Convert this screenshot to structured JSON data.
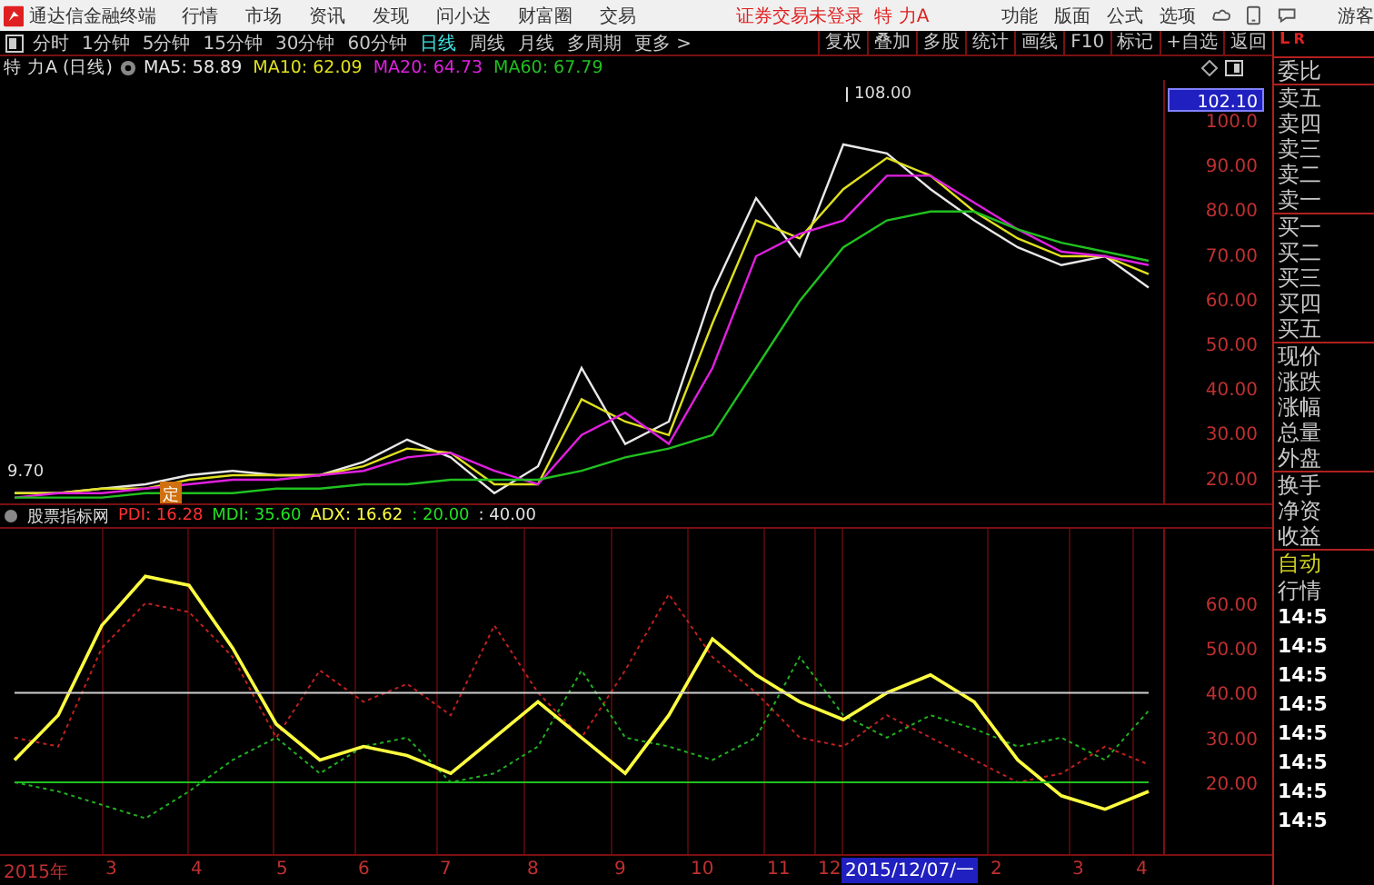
{
  "title_bar": {
    "app_name": "通达信金融终端",
    "menus": [
      "行情",
      "市场",
      "资讯",
      "发现",
      "问小达",
      "财富圈",
      "交易"
    ],
    "status": "证券交易未登录",
    "stock": "特 力A",
    "right_menus": [
      "功能",
      "版面",
      "公式",
      "选项"
    ],
    "user": "游客"
  },
  "periods": [
    {
      "label": "分时",
      "selected": false
    },
    {
      "label": "1分钟",
      "selected": false
    },
    {
      "label": "5分钟",
      "selected": false
    },
    {
      "label": "15分钟",
      "selected": false
    },
    {
      "label": "30分钟",
      "selected": false
    },
    {
      "label": "60分钟",
      "selected": false
    },
    {
      "label": "日线",
      "selected": true
    },
    {
      "label": "周线",
      "selected": false
    },
    {
      "label": "月线",
      "selected": false
    },
    {
      "label": "多周期",
      "selected": false
    },
    {
      "label": "更多 >",
      "selected": false
    }
  ],
  "tools": [
    "复权",
    "叠加",
    "多股",
    "统计",
    "画线",
    "F10",
    "标记",
    "+自选",
    "返回"
  ],
  "legend": {
    "title": "特 力A (日线)",
    "items": [
      {
        "text": "MA5: 58.89",
        "color": "#e8e8e8"
      },
      {
        "text": "MA10: 62.09",
        "color": "#e0e020"
      },
      {
        "text": "MA20: 64.73",
        "color": "#e020e0"
      },
      {
        "text": "MA60: 67.79",
        "color": "#20c020"
      }
    ]
  },
  "price_chart": {
    "high_label": "108.00",
    "low_label": "9.70",
    "marker": "定",
    "cursor_price": "102.10",
    "axis_labels": [
      "100.0",
      "90.00",
      "80.00",
      "70.00",
      "60.00",
      "50.00",
      "40.00",
      "30.00",
      "20.00"
    ]
  },
  "indicator": {
    "name": "股票指标网",
    "items": [
      {
        "text": "PDI: 16.28",
        "color": "#ff3030"
      },
      {
        "text": "MDI: 35.60",
        "color": "#20e020"
      },
      {
        "text": "ADX: 16.62",
        "color": "#ffff40"
      },
      {
        "text": ": 20.00",
        "color": "#20e020"
      },
      {
        "text": ": 40.00",
        "color": "#e0e0e0"
      }
    ],
    "chart_data": {
      "type": "line",
      "grid": true,
      "ylim": [
        4,
        77
      ],
      "yticks": [
        {
          "value": 60,
          "label": "60.00"
        },
        {
          "value": 50,
          "label": "50.00"
        },
        {
          "value": 40,
          "label": "40.00"
        },
        {
          "value": 30,
          "label": "30.00"
        },
        {
          "value": 20,
          "label": "20.00"
        }
      ],
      "series": [
        {
          "color": "#c02020",
          "line_style": "dashed",
          "values": [
            30,
            28,
            50,
            60,
            58,
            48,
            30,
            45,
            38,
            42,
            35,
            55,
            40,
            30,
            45,
            62,
            48,
            40,
            30,
            28,
            35,
            30,
            25,
            20,
            22,
            28,
            24
          ]
        },
        {
          "color": "#20b020",
          "line_style": "dashed",
          "values": [
            20,
            18,
            15,
            12,
            18,
            25,
            30,
            22,
            28,
            30,
            20,
            22,
            28,
            45,
            30,
            28,
            25,
            30,
            48,
            35,
            30,
            35,
            32,
            28,
            30,
            25,
            36
          ]
        },
        {
          "color": "#ffff40",
          "line_style": "solid",
          "values": [
            25,
            35,
            55,
            66,
            64,
            50,
            33,
            25,
            28,
            26,
            22,
            30,
            38,
            30,
            22,
            35,
            52,
            44,
            38,
            34,
            40,
            44,
            38,
            25,
            17,
            14,
            18
          ]
        },
        {
          "color": "#20c020",
          "line_style": "solid",
          "values": [
            20,
            20,
            20,
            20,
            20,
            20,
            20,
            20,
            20,
            20,
            20,
            20,
            20,
            20,
            20,
            20,
            20,
            20,
            20,
            20,
            20,
            20,
            20,
            20,
            20,
            20,
            20
          ]
        },
        {
          "color": "#d0d0d0",
          "line_style": "solid",
          "values": [
            40,
            40,
            40,
            40,
            40,
            40,
            40,
            40,
            40,
            40,
            40,
            40,
            40,
            40,
            40,
            40,
            40,
            40,
            40,
            40,
            40,
            40,
            40,
            40,
            40,
            40,
            40
          ]
        }
      ]
    }
  },
  "date_axis": [
    {
      "label": "2015年",
      "kind": "tick"
    },
    {
      "label": "3",
      "kind": "tick"
    },
    {
      "label": "4",
      "kind": "tick"
    },
    {
      "label": "5",
      "kind": "tick"
    },
    {
      "label": "6",
      "kind": "tick"
    },
    {
      "label": "7",
      "kind": "tick"
    },
    {
      "label": "8",
      "kind": "tick"
    },
    {
      "label": "9",
      "kind": "tick"
    },
    {
      "label": "10",
      "kind": "tick"
    },
    {
      "label": "11",
      "kind": "tick"
    },
    {
      "label": "12",
      "kind": "tick"
    },
    {
      "label": "2015/12/07/一",
      "kind": "cursor"
    },
    {
      "label": "2",
      "kind": "tick"
    },
    {
      "label": "3",
      "kind": "tick"
    },
    {
      "label": "4",
      "kind": "tick"
    }
  ],
  "side_panel": {
    "corner": [
      "L",
      "R"
    ],
    "groups": [
      [
        "委比"
      ],
      [
        "卖五",
        "卖四",
        "卖三",
        "卖二",
        "卖一"
      ],
      [
        "买一",
        "买二",
        "买三",
        "买四",
        "买五"
      ],
      [
        "现价",
        "涨跌",
        "涨幅",
        "总量",
        "外盘"
      ],
      [
        "换手",
        "净资",
        "收益"
      ]
    ],
    "auto": "自动",
    "tick_title": "行情",
    "ticks": [
      "14:5",
      "14:5",
      "14:5",
      "14:5",
      "14:5",
      "14:5",
      "14:5",
      "14:5"
    ]
  }
}
